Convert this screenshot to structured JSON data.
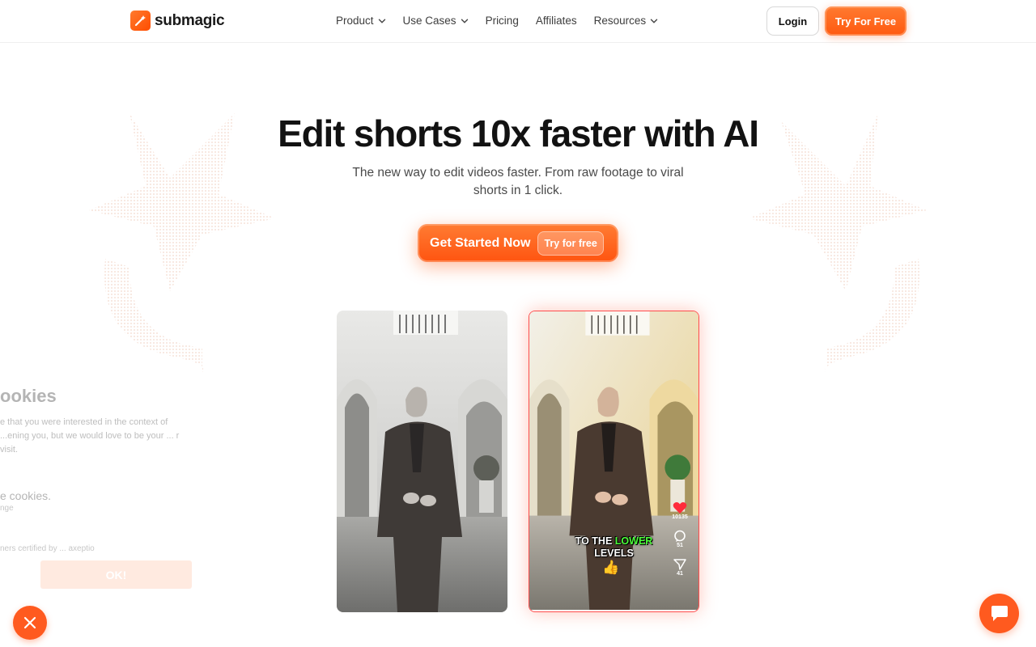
{
  "nav": {
    "brand": "submagic",
    "items": [
      {
        "label": "Product",
        "dropdown": true
      },
      {
        "label": "Use Cases",
        "dropdown": true
      },
      {
        "label": "Pricing",
        "dropdown": false
      },
      {
        "label": "Affiliates",
        "dropdown": false
      },
      {
        "label": "Resources",
        "dropdown": true
      }
    ],
    "login": "Login",
    "try": "Try For Free"
  },
  "hero": {
    "title": "Edit shorts 10x faster with AI",
    "subtitle": "The new way to edit videos faster. From raw footage to viral shorts in 1 click.",
    "cta_label": "Get Started Now",
    "cta_pill": "Try for free"
  },
  "video": {
    "caption_line1_a": "TO THE",
    "caption_line1_b": "LOWER",
    "caption_line2": "LEVELS",
    "caption_emoji": "👍",
    "likes": "10135",
    "comments": "51",
    "shares": "41"
  },
  "cookie": {
    "title": "ookies",
    "text": "e that you were interested in the context of ...ening you, but we would love to be your ... r visit.",
    "sub": "e cookies.",
    "sub2": "nge",
    "certified": "ners certified by ... axeptio",
    "ok": "OK!"
  },
  "colors": {
    "accent": "#ff5a1f",
    "highlight": "#4cff3a"
  }
}
